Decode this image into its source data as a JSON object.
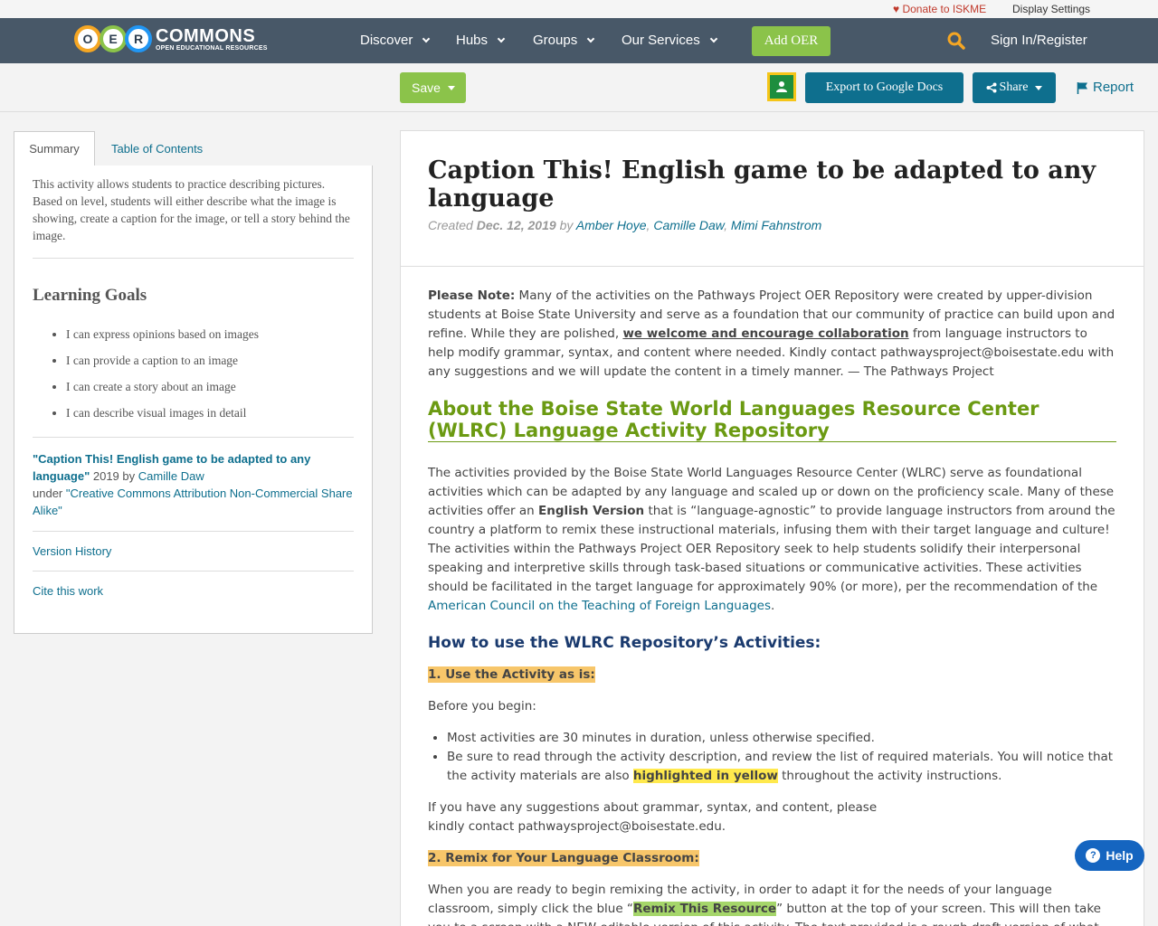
{
  "util": {
    "donate": "Donate to ISKME",
    "display": "Display Settings"
  },
  "logo": {
    "o": "O",
    "e": "E",
    "r": "R",
    "name": "COMMONS",
    "sub": "OPEN EDUCATIONAL RESOURCES"
  },
  "nav": {
    "discover": "Discover",
    "hubs": "Hubs",
    "groups": "Groups",
    "services": "Our Services",
    "add_oer": "Add OER",
    "signin": "Sign In/Register"
  },
  "actions": {
    "save": "Save",
    "export": "Export to Google Docs",
    "share": "Share",
    "report": "Report"
  },
  "sidebar": {
    "tab_summary": "Summary",
    "tab_toc": "Table of Contents",
    "summary": "This activity allows students to practice describing pictures. Based on level, students will either describe what the image is showing, create a caption for the image, or tell a story behind the image.",
    "goals_title": "Learning Goals",
    "goals": [
      "I can express opinions based on images",
      "I can provide a caption to an image",
      "I can create a story about an image",
      "I can describe visual images in detail"
    ],
    "attr_title": "\"Caption This! English game to be adapted to any language\"",
    "attr_year": "2019 by",
    "attr_author": "Camille Daw",
    "attr_under": "under",
    "attr_license": "\"Creative Commons Attribution Non-Commercial Share Alike\"",
    "version_history": "Version History",
    "cite": "Cite this work"
  },
  "main": {
    "title": "Caption This! English game to be adapted to any language",
    "created": "Created",
    "date": "Dec. 12, 2019",
    "by": "by",
    "authors": [
      "Amber Hoye",
      "Camille Daw",
      "Mimi Fahnstrom"
    ],
    "note_label": "Please Note:",
    "note_1": " Many of the activities on the Pathways Project OER Repository were created by upper-division students at Boise State University and serve as a foundation that our community of practice can build upon and refine. While they are polished, ",
    "note_link": "we welcome and encourage collaboration",
    "note_2": " from language instructors to help modify grammar, syntax, and content where needed. Kindly contact pathwaysproject@boisestate.edu with any suggestions and we will update the content in a timely manner.  — The Pathways Project",
    "about_heading": "About the Boise State World Languages Resource Center (WLRC) Language Activity Repository",
    "about_1": "The activities provided by the Boise State World Languages Resource Center (WLRC) serve as foundational activities which can be adapted by any language and scaled up or down on the proficiency scale. Many of these activities offer an ",
    "about_bold": "English Version",
    "about_2": " that is “language-agnostic” to provide language instructors from around the country a platform to remix these instructional materials, infusing them with their target language and culture! The activities within the Pathways Project OER Repository seek to help students solidify their interpersonal speaking and interpretive skills through task-based situations or communicative activities. These activities should be facilitated in the target language for approximately 90% (or more), per the recommendation of the ",
    "about_link": "American Council on the Teaching of Foreign Languages",
    "about_end": ".",
    "howto_heading": "How to use the WLRC Repository’s Activities:",
    "step1": "1. Use the Activity as is:",
    "before": "Before you begin:",
    "bullet1": "Most activities are 30 minutes in duration, unless otherwise specified.",
    "bullet2a": "Be sure to read through the activity description, and review the list of required materials. You will notice that the activity materials are also ",
    "bullet2_hl": "highlighted in yellow",
    "bullet2b": " throughout the activity instructions.",
    "suggest": "If you have any suggestions about grammar, syntax, and content, please kindly contact pathwaysproject@boisestate.edu.",
    "step2": "2. Remix for Your Language Classroom:",
    "remix_1": "When you are ready to begin remixing the activity, in order to adapt it for the needs of your language classroom, simply click the blue “",
    "remix_hl": "Remix This Resource",
    "remix_2": "” button at the top of your screen. This will then take you to a screen with a NEW editable version of this activity. The text provided is a rough draft version of what you might want to"
  },
  "help": "Help"
}
